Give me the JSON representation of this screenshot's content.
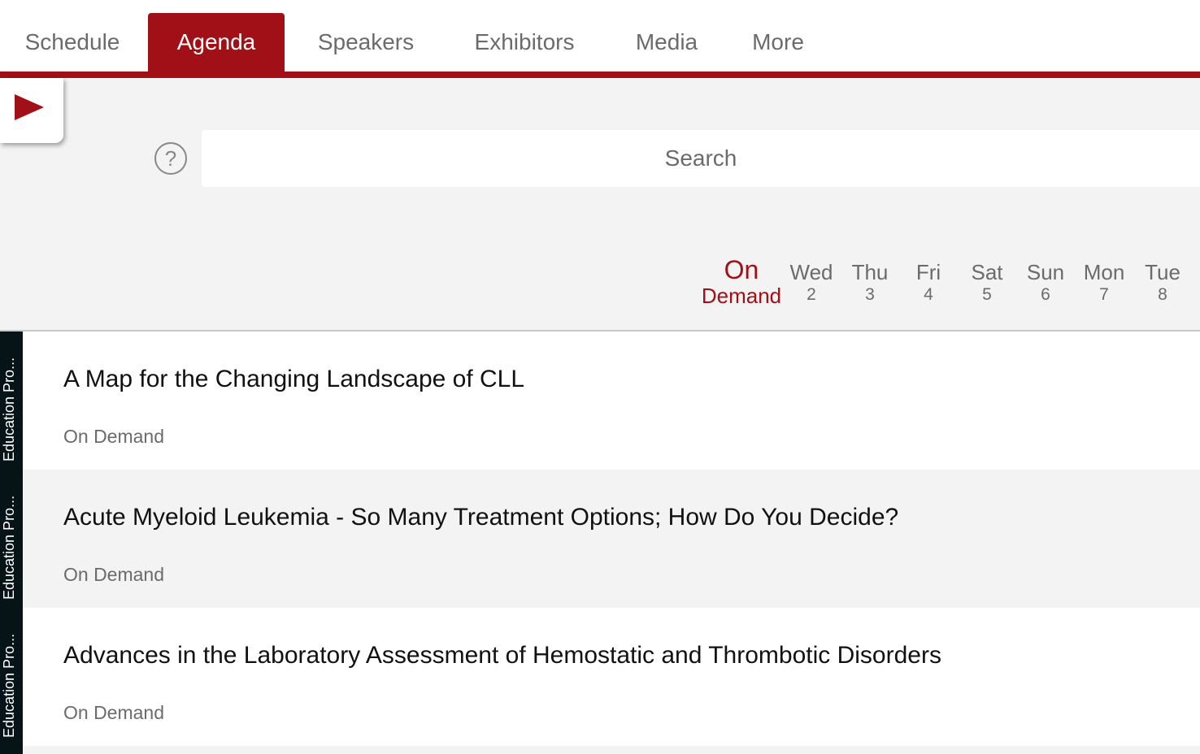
{
  "nav": {
    "tabs": [
      {
        "label": "Schedule",
        "active": false
      },
      {
        "label": "Agenda",
        "active": true
      },
      {
        "label": "Speakers",
        "active": false
      },
      {
        "label": "Exhibitors",
        "active": false
      },
      {
        "label": "Media",
        "active": false
      },
      {
        "label": "More",
        "active": false
      }
    ]
  },
  "colors": {
    "accent": "#a01016",
    "sidebar": "#061418"
  },
  "help": {
    "label": "?"
  },
  "search": {
    "placeholder": "Search"
  },
  "days": [
    {
      "name": "On",
      "date": "Demand",
      "selected": true
    },
    {
      "name": "Wed",
      "date": "2"
    },
    {
      "name": "Thu",
      "date": "3"
    },
    {
      "name": "Fri",
      "date": "4"
    },
    {
      "name": "Sat",
      "date": "5"
    },
    {
      "name": "Sun",
      "date": "6"
    },
    {
      "name": "Mon",
      "date": "7"
    },
    {
      "name": "Tue",
      "date": "8"
    }
  ],
  "sessions": [
    {
      "track": "Education Pro...",
      "title": "A Map for the Changing Landscape of CLL",
      "time": "On Demand"
    },
    {
      "track": "Education Pro...",
      "title": "Acute Myeloid Leukemia - So Many Treatment Options; How Do You Decide?",
      "time": "On Demand"
    },
    {
      "track": "Education Pro...",
      "title": "Advances in the Laboratory Assessment of Hemostatic and Thrombotic Disorders",
      "time": "On Demand"
    }
  ]
}
